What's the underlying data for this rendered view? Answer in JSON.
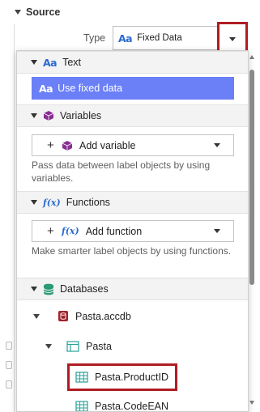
{
  "section": {
    "title": "Source"
  },
  "type_field": {
    "label": "Type",
    "icon": "text-aa-icon",
    "value": "Fixed Data"
  },
  "popup": {
    "categories": [
      {
        "id": "text",
        "label": "Text",
        "icon": "text-aa-icon",
        "items": [
          {
            "label": "Use fixed data",
            "icon": "text-aa-icon",
            "selected": true
          }
        ]
      },
      {
        "id": "variables",
        "label": "Variables",
        "icon": "cube-icon",
        "button": {
          "label": "Add variable",
          "icon": "cube-icon"
        },
        "description": "Pass data between label objects by using variables."
      },
      {
        "id": "functions",
        "label": "Functions",
        "icon": "function-fx-icon",
        "button": {
          "label": "Add function",
          "icon": "function-fx-icon"
        },
        "description": "Make smarter label objects by using functions."
      },
      {
        "id": "databases",
        "label": "Databases",
        "icon": "database-icon",
        "tree": [
          {
            "label": "Pasta.accdb",
            "icon": "access-db-icon",
            "level": 0,
            "expanded": true
          },
          {
            "label": "Pasta",
            "icon": "table-icon",
            "level": 1,
            "expanded": true
          },
          {
            "label": "Pasta.ProductID",
            "icon": "field-grid-icon",
            "level": 2,
            "highlighted": true
          },
          {
            "label": "Pasta.CodeEAN",
            "icon": "field-grid-icon",
            "level": 2
          }
        ]
      }
    ]
  },
  "colors": {
    "accent_selected": "#6b7ff7",
    "highlight_border": "#b01c24",
    "aa_icon": "#2a6bd1",
    "cube": "#8a2f93",
    "database": "#2e9a74",
    "access": "#a1242d",
    "table_icon": "#2aa198"
  }
}
